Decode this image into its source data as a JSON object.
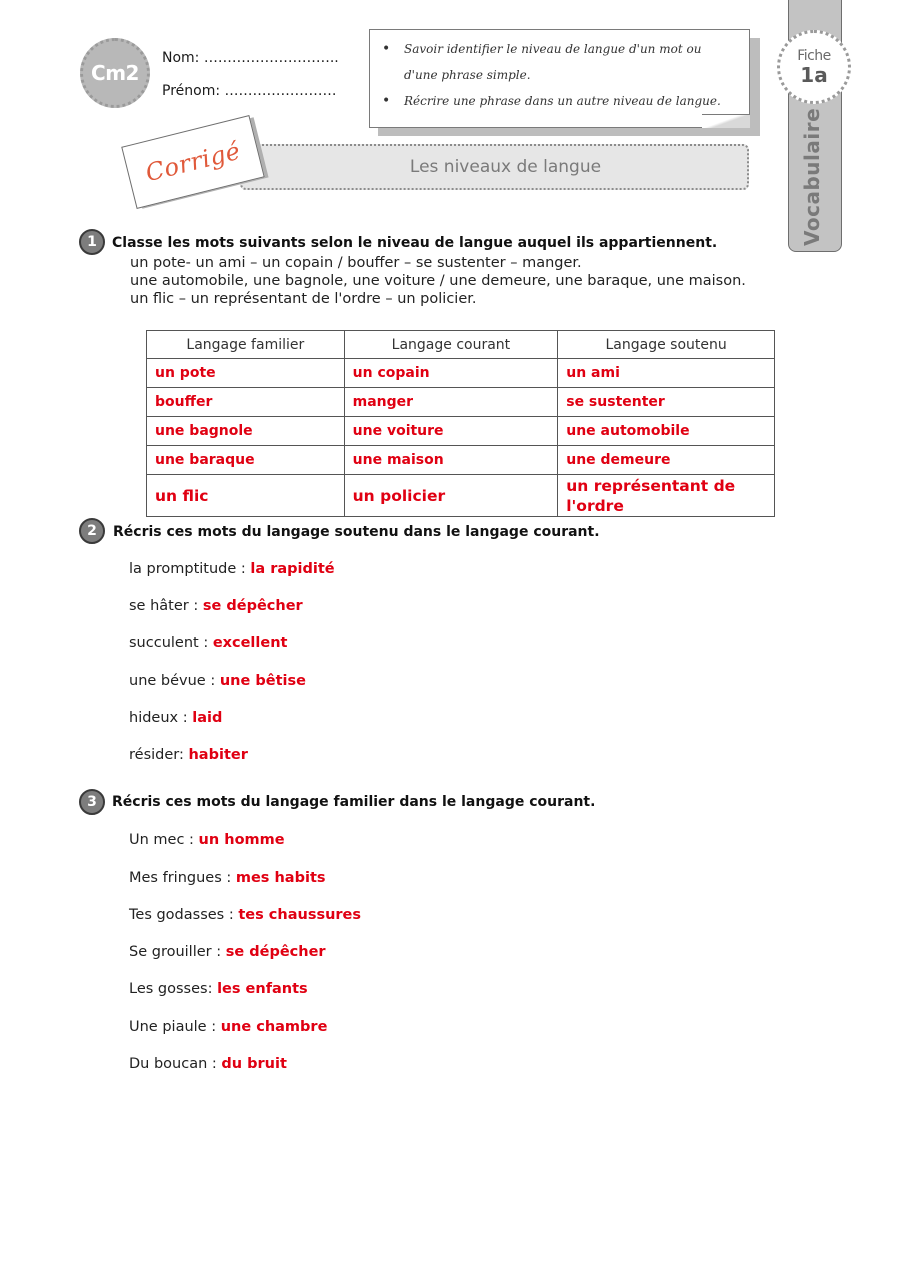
{
  "header": {
    "level": "Cm2",
    "name_label": "Nom: ………………………..",
    "firstname_label": "Prénom: ……………………",
    "objectives": [
      "Savoir identifier le niveau de langue d'un mot ou d'une phrase simple.",
      "Récrire une phrase dans un autre niveau de langue."
    ],
    "fiche_label": "Fiche",
    "fiche_number": "1a",
    "subject": "Vocabulaire",
    "stamp": "Corrigé",
    "title": "Les niveaux de langue"
  },
  "exercise1": {
    "number": "1",
    "instruction": "Classe les mots suivants selon le niveau de langue auquel ils appartiennent.",
    "word_lines": [
      "un pote- un ami – un copain / bouffer – se sustenter – manger.",
      "une automobile, une bagnole, une voiture / une demeure, une baraque, une maison.",
      "un flic – un représentant de l'ordre – un policier."
    ],
    "table": {
      "headers": [
        "Langage familier",
        "Langage courant",
        "Langage soutenu"
      ],
      "rows": [
        [
          "un pote",
          "un copain",
          "un ami"
        ],
        [
          "bouffer",
          "manger",
          "se sustenter"
        ],
        [
          "une bagnole",
          "une voiture",
          "une automobile"
        ],
        [
          "une baraque",
          "une maison",
          "une demeure"
        ],
        [
          "un flic",
          "un policier",
          "un représentant de l'ordre"
        ]
      ]
    }
  },
  "exercise2": {
    "number": "2",
    "instruction": "Récris ces mots du langage soutenu dans le langage courant.",
    "items": [
      {
        "prompt": "la promptitude : ",
        "answer": "la rapidité"
      },
      {
        "prompt": "se hâter  : ",
        "answer": "se dépêcher"
      },
      {
        "prompt": "succulent : ",
        "answer": "excellent"
      },
      {
        "prompt": "une bévue :  ",
        "answer": "une bêtise"
      },
      {
        "prompt": "hideux :  ",
        "answer": "laid"
      },
      {
        "prompt": "résider: ",
        "answer": "habiter"
      }
    ]
  },
  "exercise3": {
    "number": "3",
    "instruction": "Récris ces mots du langage familier dans le langage courant.",
    "items": [
      {
        "prompt": "Un mec : ",
        "answer": "un homme"
      },
      {
        "prompt": "Mes fringues  : ",
        "answer": "mes habits"
      },
      {
        "prompt": "Tes godasses :  ",
        "answer": "tes chaussures"
      },
      {
        "prompt": "Se grouiller :   ",
        "answer": "se dépêcher"
      },
      {
        "prompt": "Les gosses:   ",
        "answer": "les enfants"
      },
      {
        "prompt": "Une piaule :   ",
        "answer": "une chambre"
      },
      {
        "prompt": "Du boucan :   ",
        "answer": "du bruit"
      }
    ]
  },
  "colors": {
    "answer_red": "#e00012",
    "stamp_orange": "#e0593a",
    "badge_gray": "#b8b8b8",
    "tab_gray": "#c3c3c3"
  }
}
